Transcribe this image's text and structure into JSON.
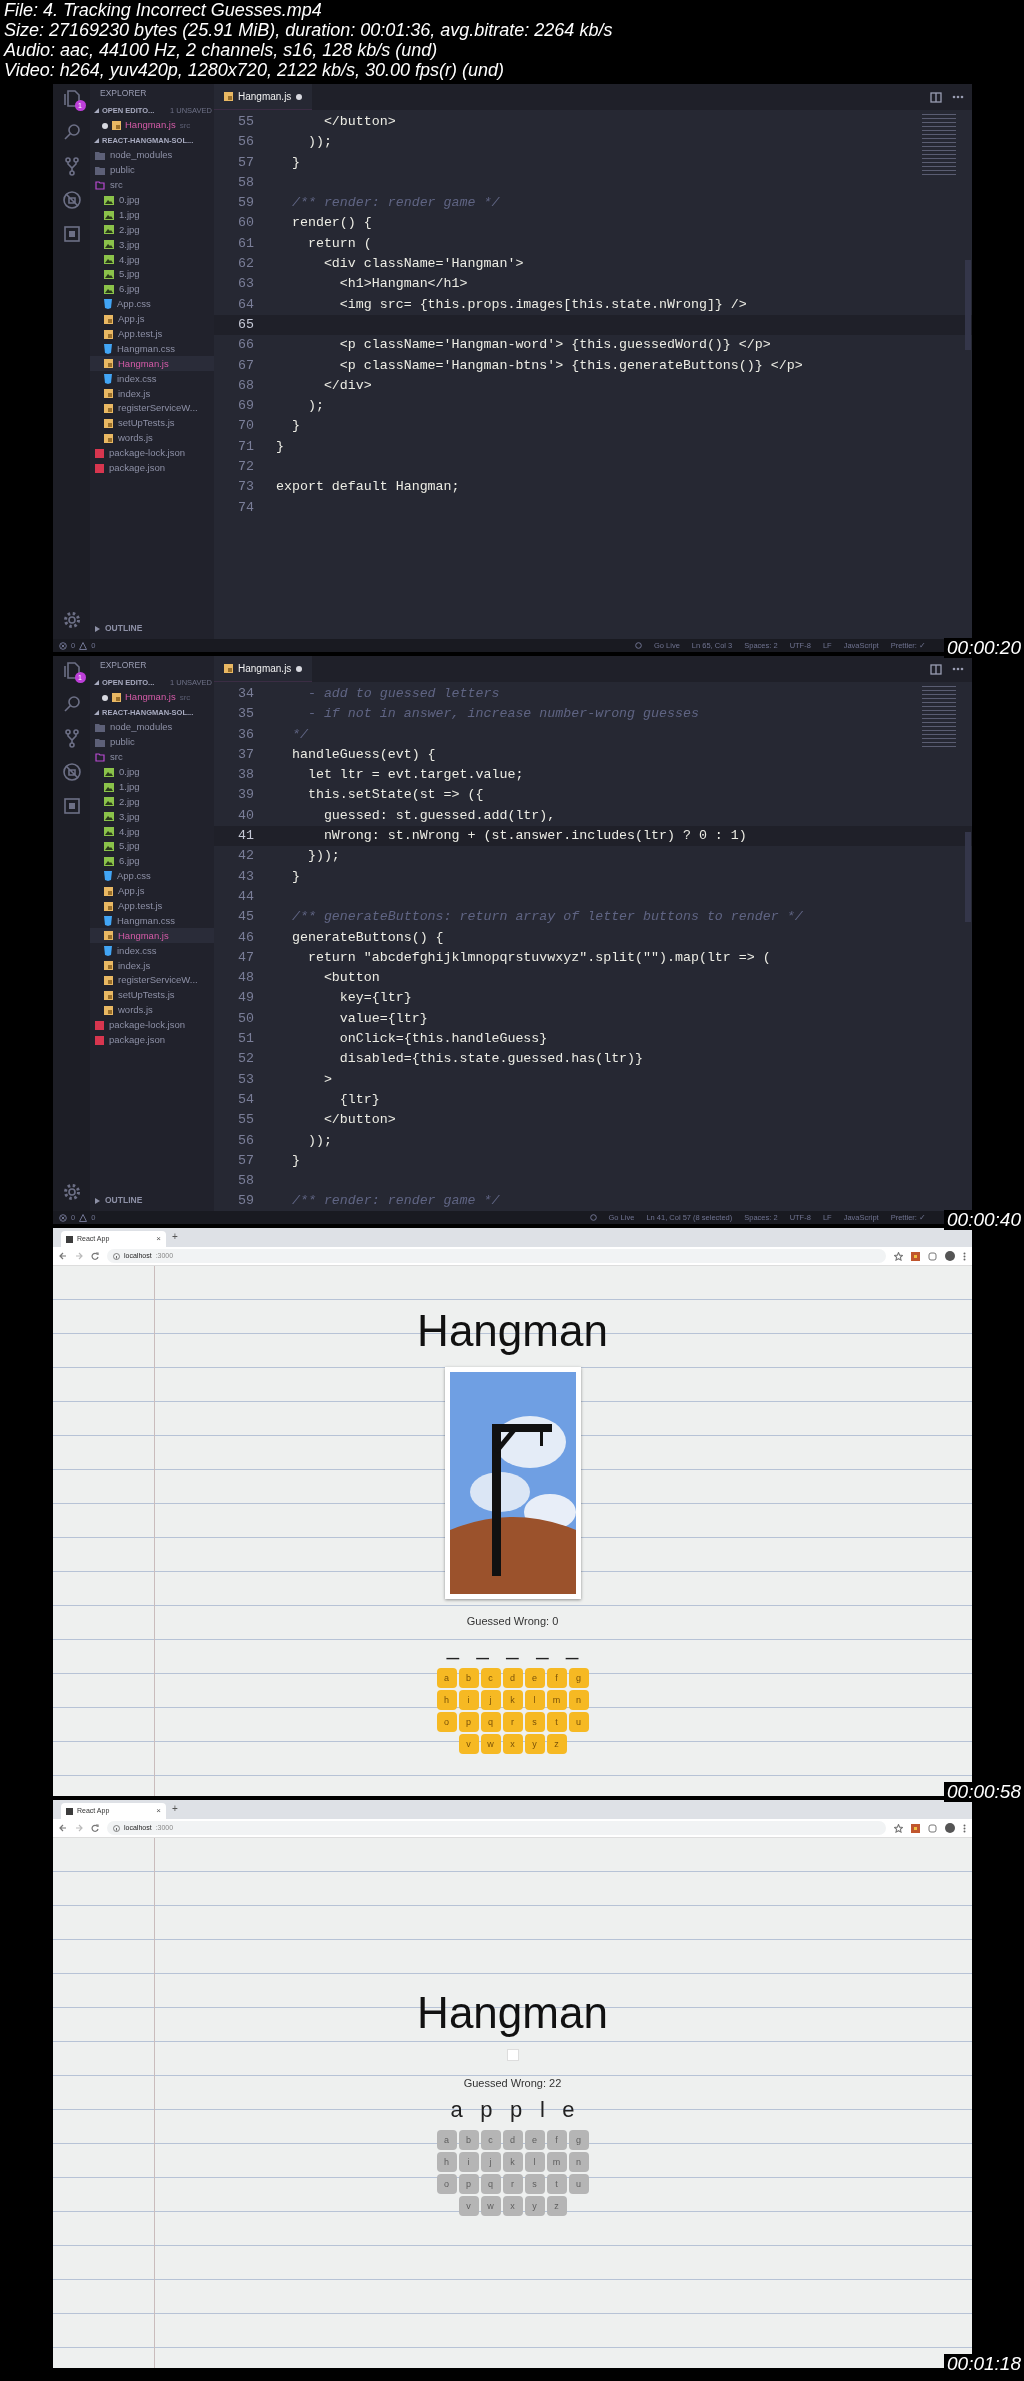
{
  "file_info": [
    "File: 4. Tracking Incorrect Guesses.mp4",
    "Size: 27169230 bytes (25.91 MiB), duration: 00:01:36, avg.bitrate: 2264 kb/s",
    "Audio: aac, 44100 Hz, 2 channels, s16, 128 kb/s (und)",
    "Video: h264, yuv420p, 1280x720, 2122 kb/s, 30.00 fps(r) (und)"
  ],
  "frames": [
    {
      "kind": "editor",
      "timestamp": "00:00:20",
      "activity_badge": "1",
      "explorer": {
        "title": "EXPLORER",
        "open_editors": {
          "label": "OPEN EDITO...",
          "note": "1 UNSAVED",
          "items": [
            {
              "label": "Hangman.js",
              "detail": "src",
              "unsaved": true
            }
          ]
        },
        "project": {
          "label": "REACT-HANGMAN-SOL...",
          "children": [
            {
              "label": "node_modules",
              "kind": "folder",
              "expanded": false,
              "selected": false
            },
            {
              "label": "public",
              "kind": "folder",
              "expanded": false,
              "selected": false
            },
            {
              "label": "src",
              "kind": "folder",
              "expanded": true,
              "selected": false,
              "children": [
                {
                  "label": "0.jpg",
                  "kind": "image",
                  "selected": false
                },
                {
                  "label": "1.jpg",
                  "kind": "image",
                  "selected": false
                },
                {
                  "label": "2.jpg",
                  "kind": "image",
                  "selected": false
                },
                {
                  "label": "3.jpg",
                  "kind": "image",
                  "selected": false
                },
                {
                  "label": "4.jpg",
                  "kind": "image",
                  "selected": false
                },
                {
                  "label": "5.jpg",
                  "kind": "image",
                  "selected": false
                },
                {
                  "label": "6.jpg",
                  "kind": "image",
                  "selected": false
                },
                {
                  "label": "App.css",
                  "kind": "css",
                  "selected": false
                },
                {
                  "label": "App.js",
                  "kind": "js",
                  "selected": false
                },
                {
                  "label": "App.test.js",
                  "kind": "js",
                  "selected": false
                },
                {
                  "label": "Hangman.css",
                  "kind": "css",
                  "selected": false
                },
                {
                  "label": "Hangman.js",
                  "kind": "js",
                  "selected": true
                },
                {
                  "label": "index.css",
                  "kind": "css",
                  "selected": false
                },
                {
                  "label": "index.js",
                  "kind": "js",
                  "selected": false
                },
                {
                  "label": "registerServiceW...",
                  "kind": "js",
                  "selected": false
                },
                {
                  "label": "setUpTests.js",
                  "kind": "js",
                  "selected": false
                },
                {
                  "label": "words.js",
                  "kind": "js",
                  "selected": false
                }
              ]
            },
            {
              "label": "package-lock.json",
              "kind": "json",
              "selected": false
            },
            {
              "label": "package.json",
              "kind": "json",
              "selected": false
            }
          ]
        },
        "outline": "OUTLINE"
      },
      "tab": {
        "label": "Hangman.js",
        "unsaved": true
      },
      "lines": [
        {
          "number": "55",
          "current": false,
          "kind": "code",
          "text": "      </button>"
        },
        {
          "number": "56",
          "current": false,
          "kind": "code",
          "text": "    ));"
        },
        {
          "number": "57",
          "current": false,
          "kind": "code",
          "text": "  }"
        },
        {
          "number": "58",
          "current": false
        },
        {
          "number": "59",
          "current": false,
          "kind": "comment",
          "text": "  /** render: render game */"
        },
        {
          "number": "60",
          "current": false,
          "kind": "code",
          "text": "  render() {"
        },
        {
          "number": "61",
          "current": false,
          "kind": "code",
          "text": "    return ("
        },
        {
          "number": "62",
          "current": false,
          "kind": "code",
          "text": "      <div className='Hangman'>"
        },
        {
          "number": "63",
          "current": false,
          "kind": "code",
          "text": "        <h1>Hangman</h1>"
        },
        {
          "number": "64",
          "current": false,
          "kind": "code",
          "text": "        <img src= {this.props.images[this.state.nWrong]} />"
        },
        {
          "number": "65",
          "current": true
        },
        {
          "number": "66",
          "current": false,
          "kind": "code",
          "text": "        <p className='Hangman-word'> {this.guessedWord()} </p>"
        },
        {
          "number": "67",
          "current": false,
          "kind": "code",
          "text": "        <p className='Hangman-btns'> {this.generateButtons()} </p>"
        },
        {
          "number": "68",
          "current": false,
          "kind": "code",
          "text": "      </div>"
        },
        {
          "number": "69",
          "current": false,
          "kind": "code",
          "text": "    );"
        },
        {
          "number": "70",
          "current": false,
          "kind": "code",
          "text": "  }"
        },
        {
          "number": "71",
          "current": false,
          "kind": "code",
          "text": "}"
        },
        {
          "number": "72",
          "current": false
        },
        {
          "number": "73",
          "current": false,
          "kind": "code",
          "text": "export default Hangman;"
        },
        {
          "number": "74",
          "current": false
        }
      ],
      "status_bar": {
        "errors": "0",
        "warnings": "0",
        "items": [
          "Go Live",
          "Ln 65, Col 3",
          "Spaces: 2",
          "UTF-8",
          "LF",
          "JavaScript",
          "Prettier: ✓"
        ]
      }
    },
    {
      "kind": "editor",
      "timestamp": "00:00:40",
      "activity_badge": "1",
      "explorer": {
        "title": "EXPLORER",
        "open_editors": {
          "label": "OPEN EDITO...",
          "note": "1 UNSAVED",
          "items": [
            {
              "label": "Hangman.js",
              "detail": "src",
              "unsaved": true
            }
          ]
        },
        "project": {
          "label": "REACT-HANGMAN-SOL...",
          "children": [
            {
              "label": "node_modules",
              "kind": "folder",
              "expanded": false,
              "selected": false
            },
            {
              "label": "public",
              "kind": "folder",
              "expanded": false,
              "selected": false
            },
            {
              "label": "src",
              "kind": "folder",
              "expanded": true,
              "selected": false,
              "children": [
                {
                  "label": "0.jpg",
                  "kind": "image",
                  "selected": false
                },
                {
                  "label": "1.jpg",
                  "kind": "image",
                  "selected": false
                },
                {
                  "label": "2.jpg",
                  "kind": "image",
                  "selected": false
                },
                {
                  "label": "3.jpg",
                  "kind": "image",
                  "selected": false
                },
                {
                  "label": "4.jpg",
                  "kind": "image",
                  "selected": false
                },
                {
                  "label": "5.jpg",
                  "kind": "image",
                  "selected": false
                },
                {
                  "label": "6.jpg",
                  "kind": "image",
                  "selected": false
                },
                {
                  "label": "App.css",
                  "kind": "css",
                  "selected": false
                },
                {
                  "label": "App.js",
                  "kind": "js",
                  "selected": false
                },
                {
                  "label": "App.test.js",
                  "kind": "js",
                  "selected": false
                },
                {
                  "label": "Hangman.css",
                  "kind": "css",
                  "selected": false
                },
                {
                  "label": "Hangman.js",
                  "kind": "js",
                  "selected": true
                },
                {
                  "label": "index.css",
                  "kind": "css",
                  "selected": false
                },
                {
                  "label": "index.js",
                  "kind": "js",
                  "selected": false
                },
                {
                  "label": "registerServiceW...",
                  "kind": "js",
                  "selected": false
                },
                {
                  "label": "setUpTests.js",
                  "kind": "js",
                  "selected": false
                },
                {
                  "label": "words.js",
                  "kind": "js",
                  "selected": false
                }
              ]
            },
            {
              "label": "package-lock.json",
              "kind": "json",
              "selected": false
            },
            {
              "label": "package.json",
              "kind": "json",
              "selected": false
            }
          ]
        },
        "outline": "OUTLINE"
      },
      "tab": {
        "label": "Hangman.js",
        "unsaved": true
      },
      "lines": [
        {
          "number": "34",
          "current": false,
          "kind": "comment",
          "text": "    - add to guessed letters"
        },
        {
          "number": "35",
          "current": false,
          "kind": "comment",
          "text": "    - if not in answer, increase number-wrong guesses"
        },
        {
          "number": "36",
          "current": false,
          "kind": "comment",
          "text": "  */"
        },
        {
          "number": "37",
          "current": false,
          "kind": "code",
          "text": "  handleGuess(evt) {"
        },
        {
          "number": "38",
          "current": false,
          "kind": "code",
          "text": "    let ltr = evt.target.value;"
        },
        {
          "number": "39",
          "current": false,
          "kind": "code",
          "text": "    this.setState(st => ({"
        },
        {
          "number": "40",
          "current": false,
          "kind": "code",
          "text": "      guessed: st.guessed.add(ltr),"
        },
        {
          "number": "41",
          "current": true,
          "kind": "code",
          "text": "      nWrong: st.nWrong + (st.answer.includes(ltr) ? 0 : 1)"
        },
        {
          "number": "42",
          "current": false,
          "kind": "code",
          "text": "    }));"
        },
        {
          "number": "43",
          "current": false,
          "kind": "code",
          "text": "  }"
        },
        {
          "number": "44",
          "current": false
        },
        {
          "number": "45",
          "current": false,
          "kind": "comment",
          "text": "  /** generateButtons: return array of letter buttons to render */"
        },
        {
          "number": "46",
          "current": false,
          "kind": "code",
          "text": "  generateButtons() {"
        },
        {
          "number": "47",
          "current": false,
          "kind": "code",
          "text": "    return \"abcdefghijklmnopqrstuvwxyz\".split(\"\").map(ltr => ("
        },
        {
          "number": "48",
          "current": false,
          "kind": "code",
          "text": "      <button"
        },
        {
          "number": "49",
          "current": false,
          "kind": "code",
          "text": "        key={ltr}"
        },
        {
          "number": "50",
          "current": false,
          "kind": "code",
          "text": "        value={ltr}"
        },
        {
          "number": "51",
          "current": false,
          "kind": "code",
          "text": "        onClick={this.handleGuess}"
        },
        {
          "number": "52",
          "current": false,
          "kind": "code",
          "text": "        disabled={this.state.guessed.has(ltr)}"
        },
        {
          "number": "53",
          "current": false,
          "kind": "code",
          "text": "      >"
        },
        {
          "number": "54",
          "current": false,
          "kind": "code",
          "text": "        {ltr}"
        },
        {
          "number": "55",
          "current": false,
          "kind": "code",
          "text": "      </button>"
        },
        {
          "number": "56",
          "current": false,
          "kind": "code",
          "text": "    ));"
        },
        {
          "number": "57",
          "current": false,
          "kind": "code",
          "text": "  }"
        },
        {
          "number": "58",
          "current": false
        },
        {
          "number": "59",
          "current": false,
          "kind": "comment",
          "text": "  /** render: render game */"
        }
      ],
      "status_bar": {
        "errors": "0",
        "warnings": "0",
        "items": [
          "Go Live",
          "Ln 41, Col 57 (8 selected)",
          "Spaces: 2",
          "UTF-8",
          "LF",
          "JavaScript",
          "Prettier: ✓"
        ]
      }
    },
    {
      "kind": "browser",
      "timestamp": "00:00:58",
      "tab": {
        "title": "React App",
        "close": "×",
        "new_tab": "+"
      },
      "address": {
        "host": "localhost",
        "port": ":3000"
      },
      "page": {
        "title": "Hangman",
        "image": {
          "kind": "photo"
        },
        "wrong_label": "Guessed Wrong: 0",
        "word": "_____",
        "letters": [
          {
            "label": "a",
            "disabled": false
          },
          {
            "label": "b",
            "disabled": false
          },
          {
            "label": "c",
            "disabled": false
          },
          {
            "label": "d",
            "disabled": false
          },
          {
            "label": "e",
            "disabled": false
          },
          {
            "label": "f",
            "disabled": false
          },
          {
            "label": "g",
            "disabled": false
          },
          {
            "label": "h",
            "disabled": false
          },
          {
            "label": "i",
            "disabled": false
          },
          {
            "label": "j",
            "disabled": false
          },
          {
            "label": "k",
            "disabled": false
          },
          {
            "label": "l",
            "disabled": false
          },
          {
            "label": "m",
            "disabled": false
          },
          {
            "label": "n",
            "disabled": false
          },
          {
            "label": "o",
            "disabled": false
          },
          {
            "label": "p",
            "disabled": false
          },
          {
            "label": "q",
            "disabled": false
          },
          {
            "label": "r",
            "disabled": false
          },
          {
            "label": "s",
            "disabled": false
          },
          {
            "label": "t",
            "disabled": false
          },
          {
            "label": "u",
            "disabled": false
          },
          {
            "label": "v",
            "disabled": false
          },
          {
            "label": "w",
            "disabled": false
          },
          {
            "label": "x",
            "disabled": false
          },
          {
            "label": "y",
            "disabled": false
          },
          {
            "label": "z",
            "disabled": false
          }
        ]
      }
    },
    {
      "kind": "browser",
      "timestamp": "00:01:18",
      "tab": {
        "title": "React App",
        "close": "×",
        "new_tab": "+"
      },
      "address": {
        "host": "localhost",
        "port": ":3000"
      },
      "page": {
        "title": "Hangman",
        "image": {
          "kind": "broken"
        },
        "wrong_label": "Guessed Wrong: 22",
        "word": "apple",
        "letters": [
          {
            "label": "a",
            "disabled": true
          },
          {
            "label": "b",
            "disabled": true
          },
          {
            "label": "c",
            "disabled": true
          },
          {
            "label": "d",
            "disabled": true
          },
          {
            "label": "e",
            "disabled": true
          },
          {
            "label": "f",
            "disabled": true
          },
          {
            "label": "g",
            "disabled": true
          },
          {
            "label": "h",
            "disabled": true
          },
          {
            "label": "i",
            "disabled": true
          },
          {
            "label": "j",
            "disabled": true
          },
          {
            "label": "k",
            "disabled": true
          },
          {
            "label": "l",
            "disabled": true
          },
          {
            "label": "m",
            "disabled": true
          },
          {
            "label": "n",
            "disabled": true
          },
          {
            "label": "o",
            "disabled": true
          },
          {
            "label": "p",
            "disabled": true
          },
          {
            "label": "q",
            "disabled": true
          },
          {
            "label": "r",
            "disabled": true
          },
          {
            "label": "s",
            "disabled": true
          },
          {
            "label": "t",
            "disabled": true
          },
          {
            "label": "u",
            "disabled": true
          },
          {
            "label": "v",
            "disabled": true
          },
          {
            "label": "w",
            "disabled": true
          },
          {
            "label": "x",
            "disabled": true
          },
          {
            "label": "y",
            "disabled": true
          },
          {
            "label": "z",
            "disabled": true
          }
        ]
      }
    }
  ]
}
